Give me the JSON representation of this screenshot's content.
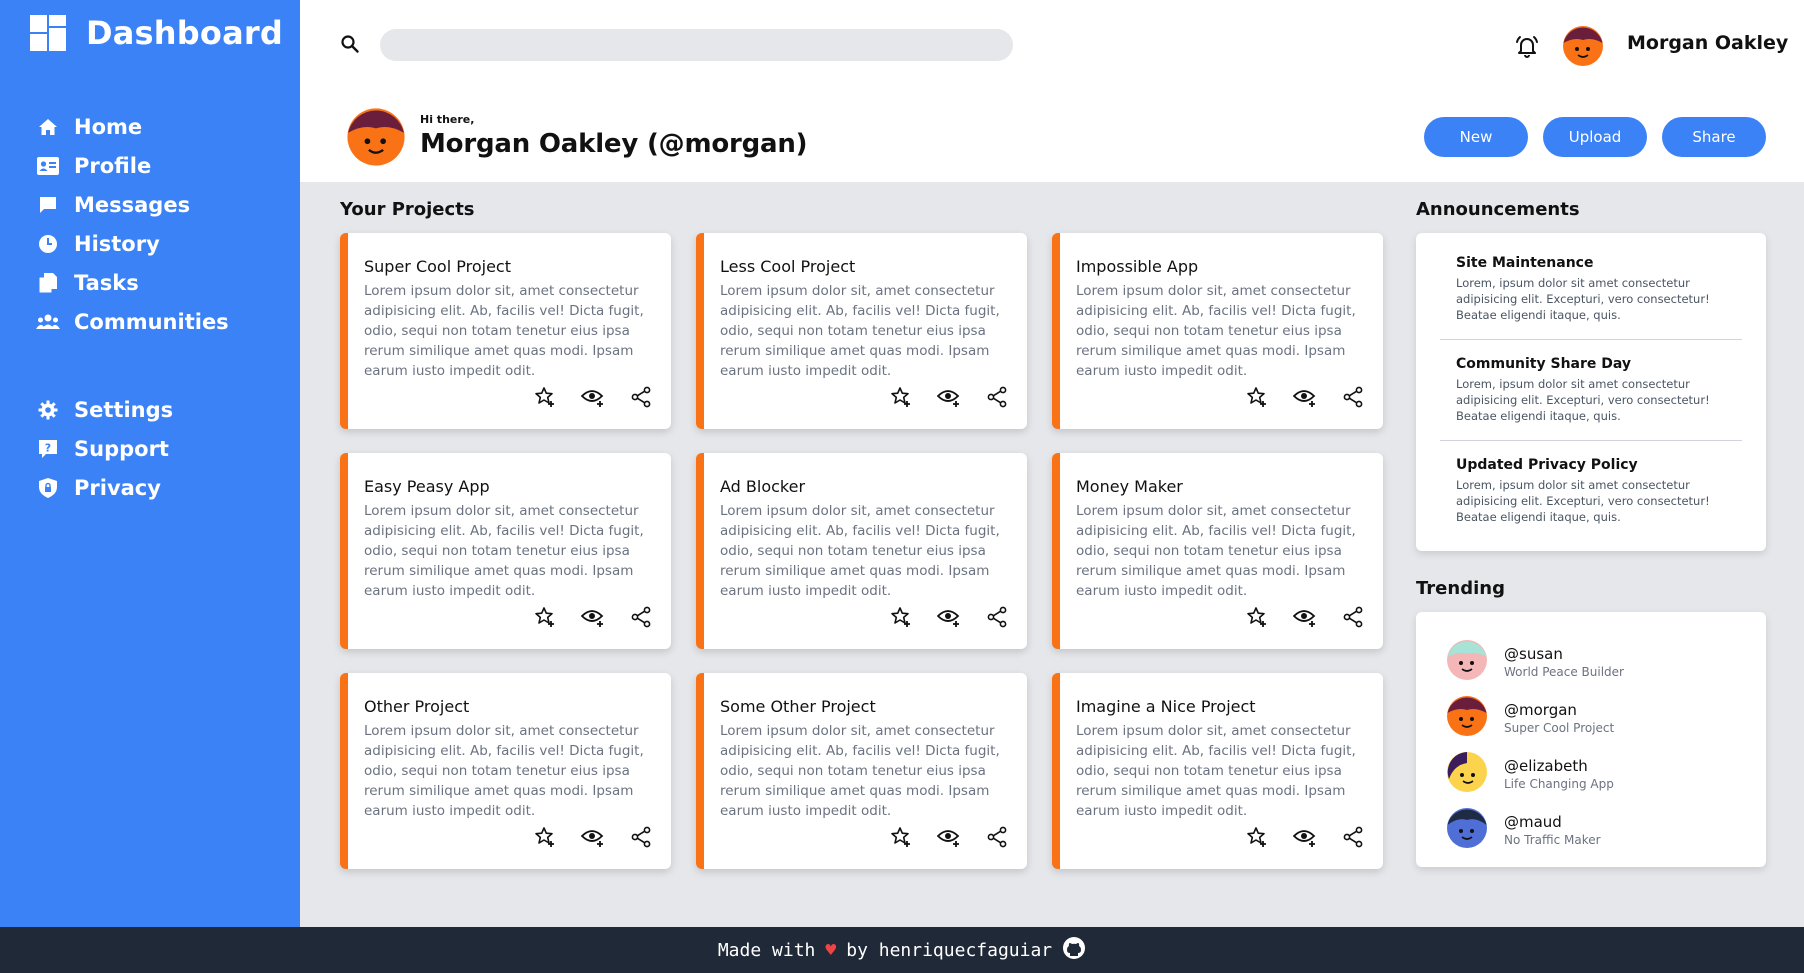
{
  "sidebar": {
    "brand": "Dashboard",
    "nav": [
      {
        "label": "Home",
        "icon": "home-icon"
      },
      {
        "label": "Profile",
        "icon": "id-card-icon"
      },
      {
        "label": "Messages",
        "icon": "chat-icon"
      },
      {
        "label": "History",
        "icon": "clock-icon"
      },
      {
        "label": "Tasks",
        "icon": "documents-icon"
      },
      {
        "label": "Communities",
        "icon": "users-icon"
      }
    ],
    "nav2": [
      {
        "label": "Settings",
        "icon": "gear-icon"
      },
      {
        "label": "Support",
        "icon": "help-icon"
      },
      {
        "label": "Privacy",
        "icon": "shield-icon"
      }
    ]
  },
  "header": {
    "search_placeholder": "",
    "user_name": "Morgan Oakley",
    "greeting_small": "Hi there,",
    "greeting_name": "Morgan Oakley (@morgan)",
    "buttons": {
      "new": "New",
      "upload": "Upload",
      "share": "Share"
    }
  },
  "projects": {
    "title": "Your Projects",
    "desc": "Lorem ipsum dolor sit, amet consectetur adipisicing elit. Ab, facilis vel! Dicta fugit, odio, sequi non totam tenetur eius ipsa rerum similique amet quas modi. Ipsam earum iusto impedit odit.",
    "items": [
      "Super Cool Project",
      "Less Cool Project",
      "Impossible App",
      "Easy Peasy App",
      "Ad Blocker",
      "Money Maker",
      "Other Project",
      "Some Other Project",
      "Imagine a Nice Project"
    ]
  },
  "announcements": {
    "title": "Announcements",
    "items": [
      {
        "title": "Site Maintenance",
        "text": "Lorem, ipsum dolor sit amet consectetur adipisicing elit. Excepturi, vero consectetur! Beatae eligendi itaque, quis."
      },
      {
        "title": "Community Share Day",
        "text": "Lorem, ipsum dolor sit amet consectetur adipisicing elit. Excepturi, vero consectetur! Beatae eligendi itaque, quis."
      },
      {
        "title": "Updated Privacy Policy",
        "text": "Lorem, ipsum dolor sit amet consectetur adipisicing elit. Excepturi, vero consectetur! Beatae eligendi itaque, quis."
      }
    ]
  },
  "trending": {
    "title": "Trending",
    "items": [
      {
        "handle": "@susan",
        "sub": "World Peace Builder"
      },
      {
        "handle": "@morgan",
        "sub": "Super Cool Project"
      },
      {
        "handle": "@elizabeth",
        "sub": "Life Changing App"
      },
      {
        "handle": "@maud",
        "sub": "No Traffic Maker"
      }
    ]
  },
  "footer": {
    "made_with": "Made with",
    "by": "by henriquecfaguiar"
  },
  "colors": {
    "sidebar": "#3b82f6",
    "accent": "#f97316",
    "footer": "#1f2937"
  }
}
